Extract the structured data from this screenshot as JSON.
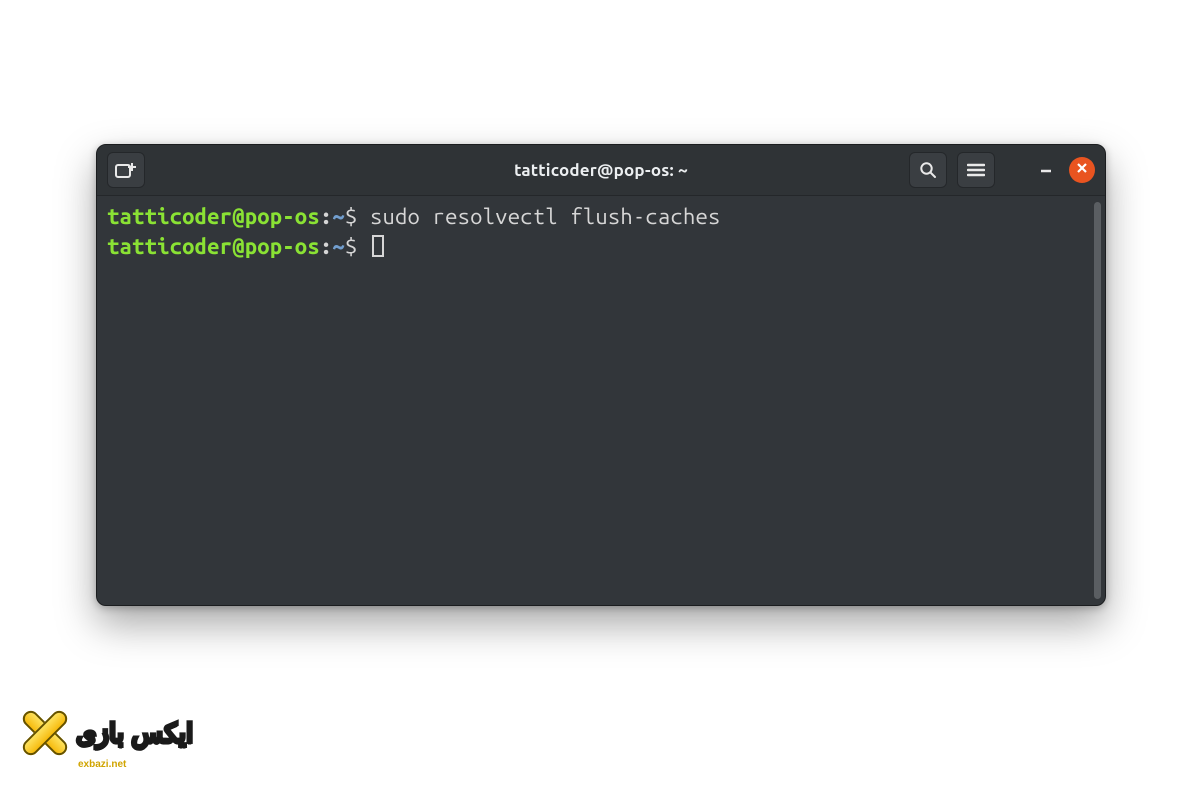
{
  "window": {
    "title": "tatticoder@pop-os: ~"
  },
  "prompt": {
    "user_host": "tatticoder@pop-os",
    "separator": ":",
    "path": "~",
    "symbol": "$"
  },
  "lines": [
    {
      "command": "sudo resolvectl flush-caches"
    },
    {
      "command": ""
    }
  ],
  "watermark": {
    "text": "ایکس بازی",
    "sub": "exbazi.net"
  },
  "icons": {
    "new_tab": "new-tab-icon",
    "search": "search-icon",
    "menu": "hamburger-menu-icon",
    "minimize": "minimize-icon",
    "close": "close-icon"
  }
}
